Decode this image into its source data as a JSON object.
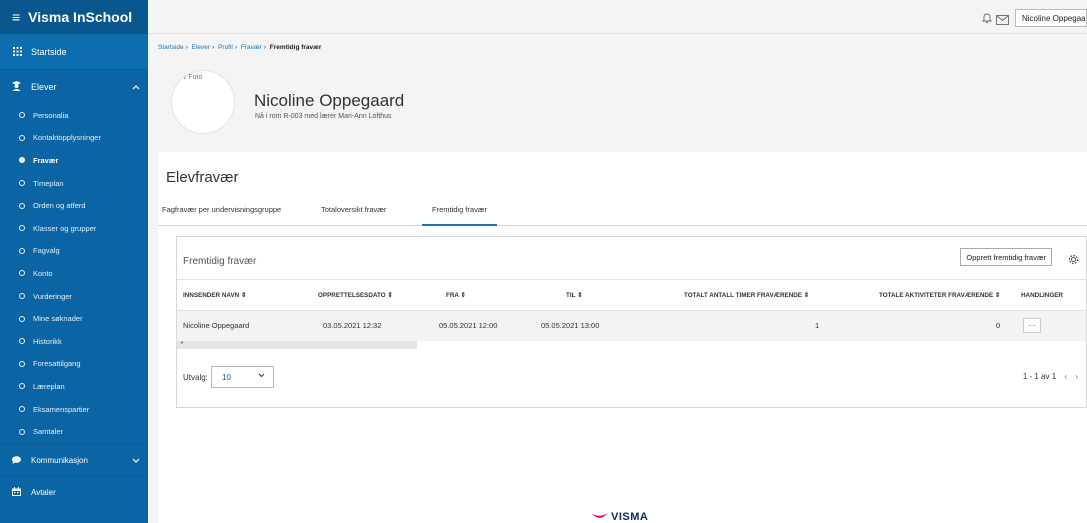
{
  "app": {
    "title": "Visma InSchool"
  },
  "sidebar": {
    "home": "Startside",
    "group_elever": "Elever",
    "items": [
      {
        "label": "Personalia",
        "active": false
      },
      {
        "label": "Kontaktopplysninger",
        "active": false
      },
      {
        "label": "Fravær",
        "active": true
      },
      {
        "label": "Timeplan",
        "active": false
      },
      {
        "label": "Orden og atferd",
        "active": false
      },
      {
        "label": "Klasser og grupper",
        "active": false
      },
      {
        "label": "Fagvalg",
        "active": false
      },
      {
        "label": "Konto",
        "active": false
      },
      {
        "label": "Vurderinger",
        "active": false
      },
      {
        "label": "Mine søknader",
        "active": false
      },
      {
        "label": "Historikk",
        "active": false
      },
      {
        "label": "Foresattilgang",
        "active": false
      },
      {
        "label": "Læreplan",
        "active": false
      },
      {
        "label": "Eksamenspartier",
        "active": false
      },
      {
        "label": "Samtaler",
        "active": false
      }
    ],
    "group_kommunikasjon": "Kommunikasjon",
    "group_avtaler": "Avtaler"
  },
  "topbar": {
    "user": "Nicoline Oppegaar"
  },
  "breadcrumb": [
    "Startside",
    "Elever",
    "Profil",
    "Fravær",
    "Fremtidig fravær"
  ],
  "profile": {
    "photo_alt": "Elev Foto",
    "photo_visible": "ev Foto",
    "name": "Nicoline Oppegaard",
    "subtitle": "Nå i rom R-003 med lærer Mari-Ann Lofthus"
  },
  "page": {
    "title": "Elevfravær"
  },
  "tabs": [
    {
      "label": "Fagfravær per undervisningsgruppe",
      "active": false
    },
    {
      "label": "Totaloversikt fravær",
      "active": false
    },
    {
      "label": "Fremtidig fravær",
      "active": true
    }
  ],
  "card": {
    "title": "Fremtidig fravær",
    "create_button": "Opprett fremtidig fravær"
  },
  "table": {
    "columns": [
      "INNSENDER NAVN ⇕",
      "OPPRETTELSESDATO ⇕",
      "FRA ⇕",
      "TIL ⇕",
      "TOTALT ANTALL TIMER FRAVÆRENDE ⇕",
      "TOTALE AKTIVITETER FRAVÆRENDE ⇕",
      "HANDLINGER"
    ],
    "rows": [
      [
        "Nicoline Oppegaard",
        "03.05.2021 12:32",
        "05.05.2021 12:00",
        "05.05.2021 13:00",
        "1",
        "0",
        "⋯"
      ]
    ]
  },
  "pagination": {
    "utvalg_label": "Utvalg:",
    "page_size": "10",
    "range": "1 - 1 av 1"
  },
  "footer": {
    "logo": "VISMA"
  },
  "colors": {
    "sidebar": "#0b64a3",
    "accent": "#1a73b8",
    "brand_red": "#e4003b"
  }
}
